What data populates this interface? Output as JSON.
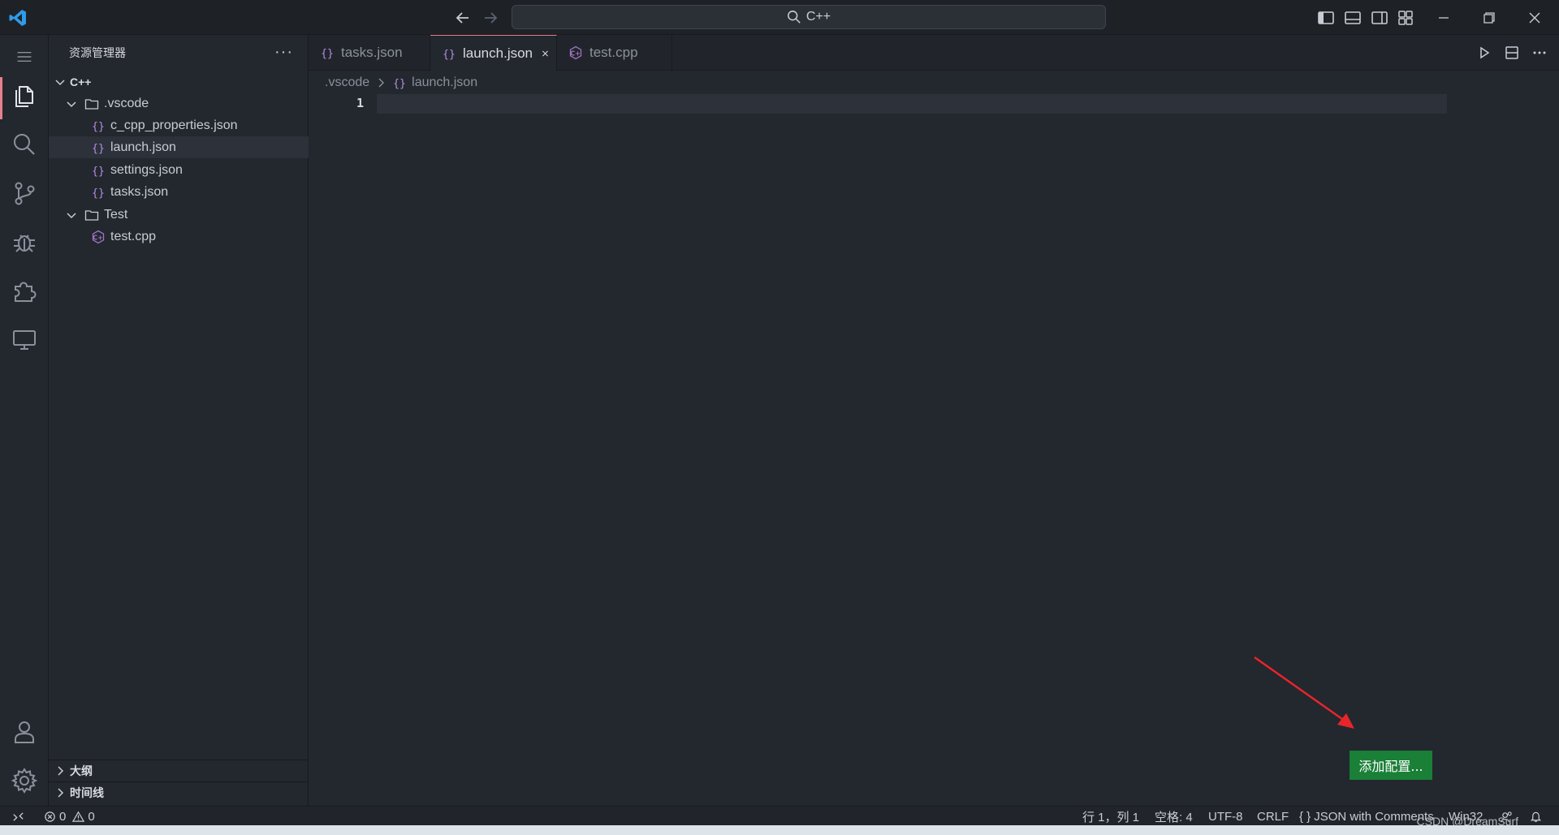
{
  "titlebar": {
    "search_text": "C++",
    "icons": [
      "vscode-logo-icon",
      "back-arrow-icon",
      "forward-arrow-icon",
      "search-icon",
      "toggle-primary-sidebar-icon",
      "toggle-panel-icon",
      "toggle-secondary-sidebar-icon",
      "customize-layout-icon",
      "minimize-icon",
      "restore-icon",
      "close-icon"
    ]
  },
  "activitybar": {
    "items": [
      "explorer-icon",
      "search-icon",
      "source-control-icon",
      "run-debug-icon",
      "extensions-icon",
      "remote-explorer-icon"
    ],
    "bottom": [
      "accounts-icon",
      "manage-gear-icon"
    ]
  },
  "sidebar": {
    "title": "资源管理器",
    "more": "···",
    "root": "C++",
    "tree": [
      {
        "label": ".vscode",
        "type": "folder"
      },
      {
        "label": "c_cpp_properties.json",
        "type": "json"
      },
      {
        "label": "launch.json",
        "type": "json"
      },
      {
        "label": "settings.json",
        "type": "json"
      },
      {
        "label": "tasks.json",
        "type": "json"
      },
      {
        "label": "Test",
        "type": "folder"
      },
      {
        "label": "test.cpp",
        "type": "cpp"
      }
    ],
    "outline": "大纲",
    "timeline": "时间线"
  },
  "tabs": [
    {
      "label": "tasks.json"
    },
    {
      "label": "launch.json"
    },
    {
      "label": "test.cpp"
    }
  ],
  "breadcrumb": {
    "folder": ".vscode",
    "file": "launch.json"
  },
  "editor": {
    "line_number": "1"
  },
  "add_config_label": "添加配置...",
  "statusbar": {
    "errors": "0",
    "warnings": "0",
    "position": "行 1，列 1",
    "spaces": "空格: 4",
    "encoding": "UTF-8",
    "eol": "CRLF",
    "language_braces": "{ }",
    "language": "JSON with Comments",
    "platform": "Win32"
  },
  "watermark": "CSDN @DreamSurf",
  "colors": {
    "accent": "#e5808e",
    "button_green": "#1a7f37",
    "annotation_red": "#e8252b",
    "json_icon": "#b58ee6",
    "cpp_icon": "#a074c4"
  }
}
